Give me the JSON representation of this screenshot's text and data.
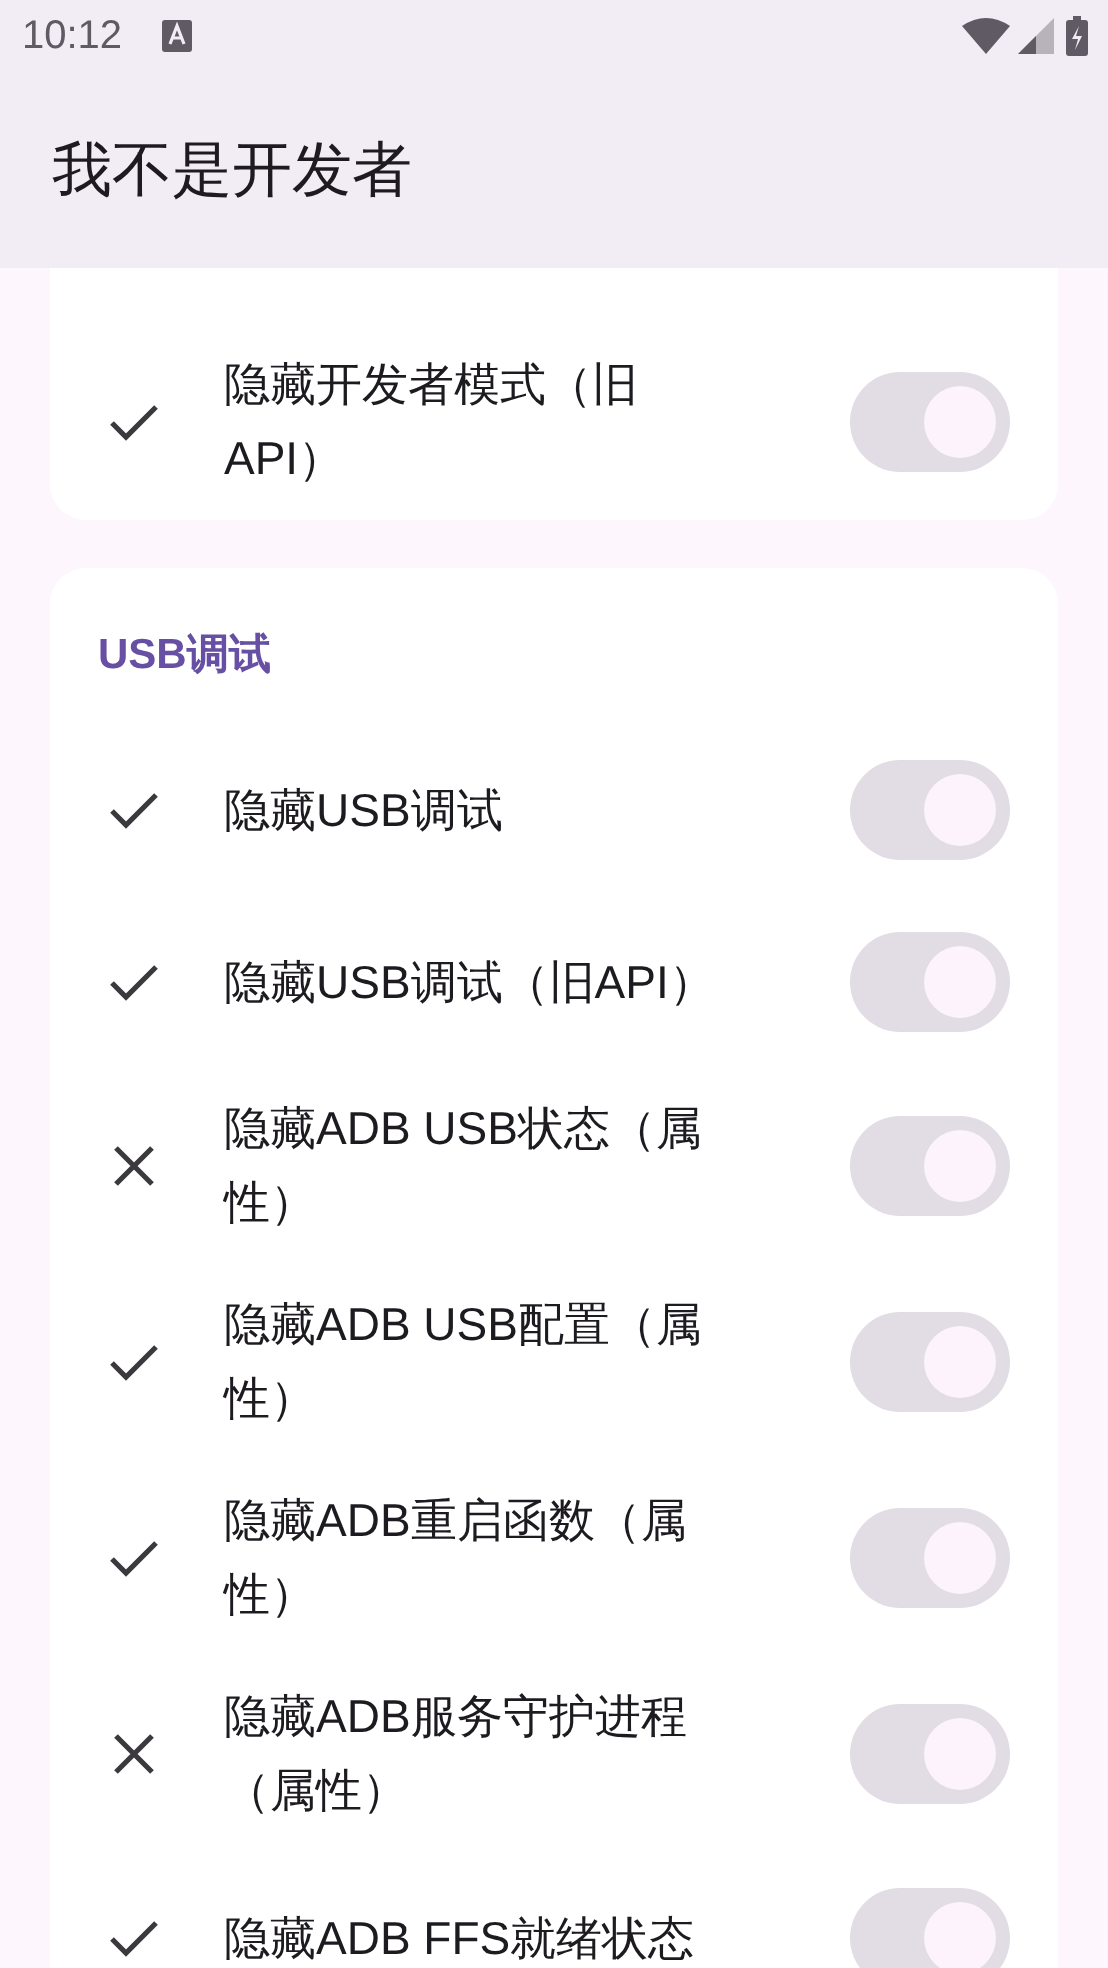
{
  "status_bar": {
    "time": "10:12"
  },
  "app_bar": {
    "title": "我不是开发者"
  },
  "sections": [
    {
      "items": [
        {
          "label": "隐藏开发者模式（旧API）",
          "kind": "check",
          "on": true,
          "disabled": true
        }
      ]
    },
    {
      "title": "USB调试",
      "items": [
        {
          "label": "隐藏USB调试",
          "kind": "check",
          "on": true,
          "disabled": true
        },
        {
          "label": "隐藏USB调试（旧API）",
          "kind": "check",
          "on": true,
          "disabled": true
        },
        {
          "label": "隐藏ADB USB状态（属性）",
          "kind": "cross",
          "on": true,
          "disabled": true
        },
        {
          "label": "隐藏ADB USB配置（属性）",
          "kind": "check",
          "on": true,
          "disabled": true
        },
        {
          "label": "隐藏ADB重启函数（属性）",
          "kind": "check",
          "on": true,
          "disabled": true
        },
        {
          "label": "隐藏ADB服务守护进程（属性）",
          "kind": "cross",
          "on": true,
          "disabled": true
        },
        {
          "label": "隐藏ADB FFS就绪状态",
          "kind": "check",
          "on": true,
          "disabled": true
        }
      ]
    }
  ]
}
